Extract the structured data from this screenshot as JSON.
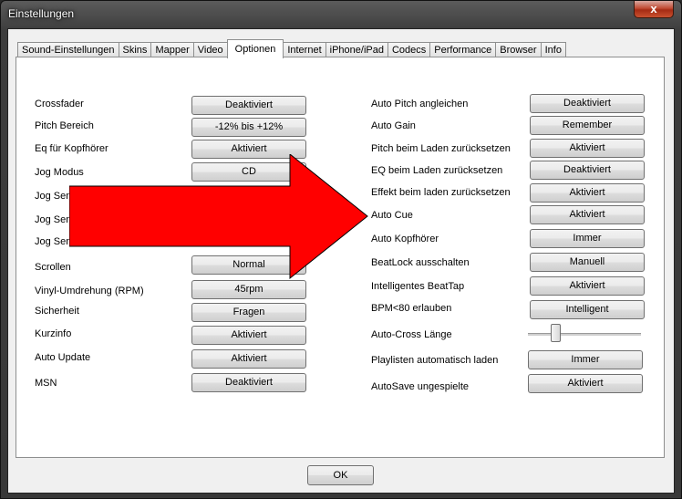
{
  "window": {
    "title": "Einstellungen",
    "close_glyph": "x"
  },
  "tabs": [
    {
      "label": "Sound-Einstellungen"
    },
    {
      "label": "Skins"
    },
    {
      "label": "Mapper"
    },
    {
      "label": "Video"
    },
    {
      "label": "Optionen",
      "active": true
    },
    {
      "label": "Internet"
    },
    {
      "label": "iPhone/iPad"
    },
    {
      "label": "Codecs"
    },
    {
      "label": "Performance"
    },
    {
      "label": "Browser"
    },
    {
      "label": "Info"
    }
  ],
  "left": [
    {
      "label": "Crossfader",
      "value": "Deaktiviert"
    },
    {
      "label": "Pitch Bereich",
      "value": "-12% bis +12%"
    },
    {
      "label": "Eq für Kopfhörer",
      "value": "Aktiviert"
    },
    {
      "label": "Jog Modus",
      "value": "CD"
    },
    {
      "label": "Jog Sen",
      "value": ""
    },
    {
      "label": "Jog Sen",
      "value": ""
    },
    {
      "label": "Jog Sen",
      "value": ""
    },
    {
      "label": "Scrollen",
      "value": "Normal"
    },
    {
      "label": "Vinyl-Umdrehung (RPM)",
      "value": "45rpm"
    },
    {
      "label": "Sicherheit",
      "value": "Fragen"
    },
    {
      "label": "Kurzinfo",
      "value": "Aktiviert"
    },
    {
      "label": "Auto Update",
      "value": "Aktiviert"
    },
    {
      "label": "MSN",
      "value": "Deaktiviert"
    }
  ],
  "right": [
    {
      "label": "Auto Pitch angleichen",
      "value": "Deaktiviert"
    },
    {
      "label": "Auto Gain",
      "value": "Remember"
    },
    {
      "label": "Pitch beim Laden zurücksetzen",
      "value": "Aktiviert"
    },
    {
      "label": "EQ beim Laden zurücksetzen",
      "value": "Deaktiviert"
    },
    {
      "label": "Effekt beim laden zurücksetzen",
      "value": "Aktiviert"
    },
    {
      "label": "Auto Cue",
      "value": "Aktiviert"
    },
    {
      "label": "Auto Kopfhörer",
      "value": "Immer"
    },
    {
      "label": "BeatLock ausschalten",
      "value": "Manuell"
    },
    {
      "label": "Intelligentes BeatTap",
      "value": "Aktiviert"
    },
    {
      "label": "BPM<80 erlauben",
      "value": "Intelligent"
    },
    {
      "label": "Auto-Cross Länge"
    },
    {
      "label": "Playlisten automatisch laden",
      "value": "Immer"
    },
    {
      "label": "AutoSave ungespielte",
      "value": "Aktiviert"
    }
  ],
  "footer": {
    "ok_label": "OK"
  },
  "overlay": {
    "arrow_color": "#ff0000"
  }
}
